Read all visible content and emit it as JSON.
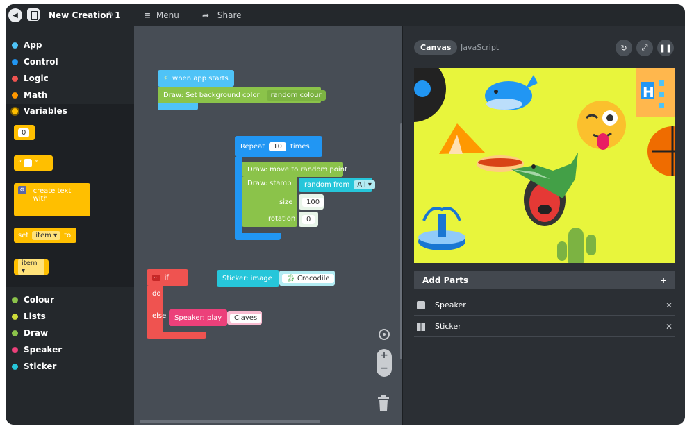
{
  "topbar": {
    "title": "New Creation 1",
    "menu_label": "Menu",
    "share_label": "Share"
  },
  "palette": {
    "categories": [
      {
        "label": "App",
        "color": "#4fc3f7"
      },
      {
        "label": "Control",
        "color": "#2196f3"
      },
      {
        "label": "Logic",
        "color": "#ef5350"
      },
      {
        "label": "Math",
        "color": "#ff9800"
      },
      {
        "label": "Variables",
        "color": "#ffbf00"
      },
      {
        "label": "Colour",
        "color": "#8bc34a"
      },
      {
        "label": "Lists",
        "color": "#cddc39"
      },
      {
        "label": "Draw",
        "color": "#8bc34a"
      },
      {
        "label": "Speaker",
        "color": "#ec407a"
      },
      {
        "label": "Sticker",
        "color": "#26c6da"
      }
    ],
    "flyout": {
      "number_value": "0",
      "text_open_quote": "“",
      "text_close_quote": "”",
      "create_text_label": "create text with",
      "set_label": "set",
      "set_var": "item",
      "to_label": "to",
      "get_var": "item"
    }
  },
  "workspace": {
    "when_app_starts": "when app starts",
    "set_background": "Draw: Set background color",
    "random_colour": "random colour",
    "repeat_label": "Repeat",
    "repeat_count": "10",
    "times_label": "times",
    "move_random": "Draw: move to random point",
    "stamp_label": "Draw: stamp",
    "random_from": "random from",
    "random_from_value": "All",
    "size_label": "size",
    "size_value": "100",
    "rotation_label": "rotation",
    "rotation_value": "0",
    "if_label": "if",
    "do_label": "do",
    "else_label": "else",
    "sticker_image": "Sticker: image",
    "sticker_value": "Crocodile",
    "speaker_play": "Speaker: play",
    "speaker_value": "Claves"
  },
  "right": {
    "tab_canvas": "Canvas",
    "tab_js": "JavaScript",
    "add_parts": "Add Parts",
    "add_plus": "+",
    "parts": [
      {
        "label": "Speaker",
        "icon": "speaker-icon"
      },
      {
        "label": "Sticker",
        "icon": "sticker-icon"
      }
    ]
  }
}
